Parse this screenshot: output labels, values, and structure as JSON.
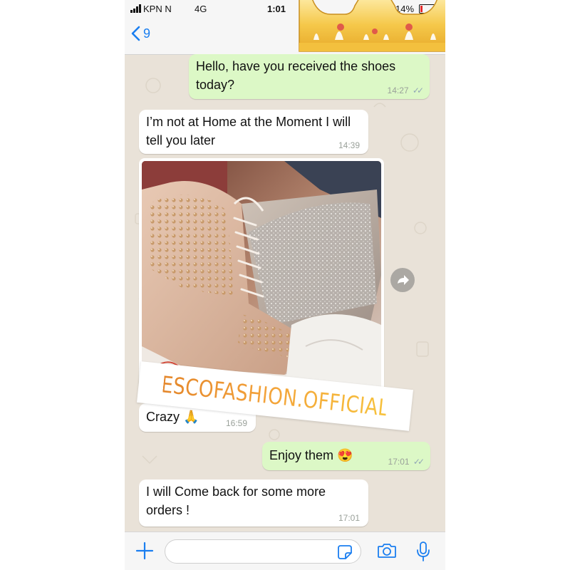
{
  "status_bar": {
    "carrier": "KPN N",
    "network": "4G",
    "time": "1:01",
    "battery_percent": "14%",
    "battery_level": 0.14,
    "battery_color": "#e32a2a"
  },
  "header": {
    "back_count": "9",
    "icons": [
      "chevron-left-icon",
      "video-camera-icon",
      "phone-icon"
    ],
    "accent_color": "#1a7ef0"
  },
  "messages": [
    {
      "direction": "outgoing",
      "text": "Hello, have you received the shoes today?",
      "time": "14:27",
      "ticks": "✓✓"
    },
    {
      "direction": "incoming",
      "text": "I’m not at Home at the Moment I will tell you later",
      "time": "14:39"
    },
    {
      "direction": "incoming",
      "type": "image",
      "alt": "studded sneaker photo"
    },
    {
      "direction": "incoming",
      "text": "Crazy 🙏",
      "time": "16:59"
    },
    {
      "direction": "outgoing",
      "text": "Enjoy them 😍",
      "time": "17:01",
      "ticks": "✓✓"
    },
    {
      "direction": "incoming",
      "text": "I will Come back for some more orders !",
      "time": "17:01"
    }
  ],
  "watermark": "ESCOFASHION.OFFICIAL",
  "input_bar": {
    "placeholder": "",
    "icons": [
      "plus-icon",
      "sticker-icon",
      "camera-icon",
      "microphone-icon"
    ]
  },
  "colors": {
    "outgoing_bubble": "#dcf8c6",
    "incoming_bubble": "#ffffff",
    "chat_background": "#e9e2d8"
  }
}
